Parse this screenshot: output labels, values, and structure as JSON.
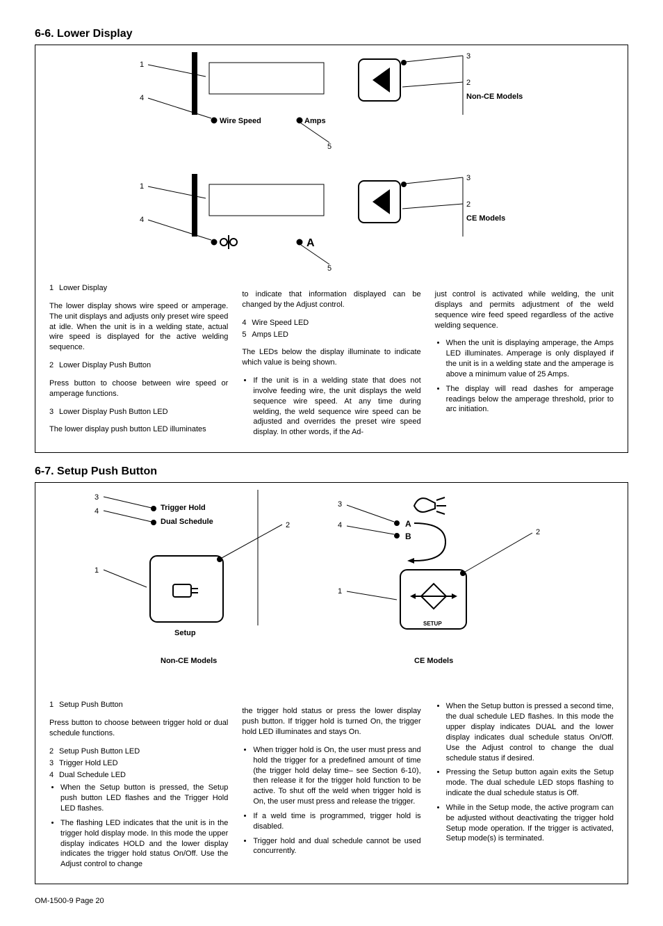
{
  "section66": {
    "heading": "6-6.   Lower Display",
    "labels": {
      "wire_speed": "Wire Speed",
      "amps": "Amps",
      "non_ce": "Non-CE Models",
      "ce": "CE Models",
      "n1": "1",
      "n2": "2",
      "n3": "3",
      "n4": "4",
      "n5": "5"
    },
    "col1": {
      "l1_num": "1",
      "l1_txt": "Lower Display",
      "p1": "The lower display shows wire speed or amperage. The unit displays and adjusts only preset wire speed at idle. When the unit is in a welding state, actual wire speed is displayed for the active welding sequence.",
      "l2_num": "2",
      "l2_txt": "Lower Display Push Button",
      "p2": "Press button to choose between wire speed or amperage functions.",
      "l3_num": "3",
      "l3_txt": "Lower Display Push Button LED",
      "p3": "The lower display push button LED illuminates"
    },
    "col2": {
      "p1": "to indicate that information displayed can be changed by the Adjust control.",
      "l4_num": "4",
      "l4_txt": "Wire Speed LED",
      "l5_num": "5",
      "l5_txt": "Amps LED",
      "p2": "The LEDs below the display illuminate to indicate which value is being shown.",
      "b1": "If the unit is in a welding state that does not involve feeding wire, the unit displays the weld sequence wire speed. At any time during welding, the weld sequence wire speed can be adjusted and overrides the preset wire speed display. In other words, if the Ad-"
    },
    "col3": {
      "p1": "just control is activated while welding, the unit displays and permits adjustment of the weld sequence wire feed speed regardless of the active welding sequence.",
      "b1": "When the unit is displaying amperage, the Amps LED illuminates. Amperage is only displayed if the unit is in a welding state and the amperage is above a minimum value of 25 Amps.",
      "b2": "The display will read dashes for amperage readings below the amperage threshold, prior to arc initiation."
    }
  },
  "section67": {
    "heading": "6-7.   Setup Push Button",
    "labels": {
      "trigger_hold": "Trigger Hold",
      "dual_schedule": "Dual Schedule",
      "setup": "Setup",
      "non_ce": "Non-CE Models",
      "ce": "CE Models",
      "n1": "1",
      "n2": "2",
      "n3": "3",
      "n4": "4",
      "a": "A",
      "b": "B"
    },
    "col1": {
      "l1_num": "1",
      "l1_txt": "Setup Push Button",
      "p1": "Press button to choose between trigger hold or dual schedule functions.",
      "l2_num": "2",
      "l2_txt": "Setup Push Button LED",
      "l3_num": "3",
      "l3_txt": "Trigger Hold LED",
      "l4_num": "4",
      "l4_txt": "Dual Schedule LED",
      "b1": "When the Setup button is pressed, the Setup push button LED flashes and the Trigger Hold LED flashes.",
      "b2": "The flashing LED indicates that the unit is in the trigger hold display mode. In this mode the upper display indicates HOLD and the lower display indicates the trigger hold status On/Off. Use the Adjust control to change"
    },
    "col2": {
      "p1": "the trigger hold status or press the lower display push button. If trigger hold is turned On, the trigger hold LED illuminates and stays On.",
      "b1": "When trigger hold is On, the user must press and hold the trigger for a predefined amount of time (the trigger hold delay time– see Section 6-10), then release it for the trigger hold function to be active. To shut off the weld when trigger hold is On, the user must press and release the trigger.",
      "b2": "If a weld time is programmed, trigger hold is disabled.",
      "b3": "Trigger hold and dual schedule cannot be used concurrently."
    },
    "col3": {
      "b1": "When the Setup button is pressed a second time, the dual schedule LED flashes. In this mode the upper display indicates DUAL and the lower display indicates dual schedule status On/Off. Use the Adjust control to change the dual schedule status if desired.",
      "b2": "Pressing the Setup button again exits the Setup mode. The dual schedule LED stops flashing to indicate the dual schedule status is Off.",
      "b3": "While in the Setup mode, the active program can be adjusted without deactivating the trigger hold Setup mode operation. If the trigger is activated, Setup mode(s) is terminated."
    }
  },
  "footer": "OM-1500-9 Page 20"
}
